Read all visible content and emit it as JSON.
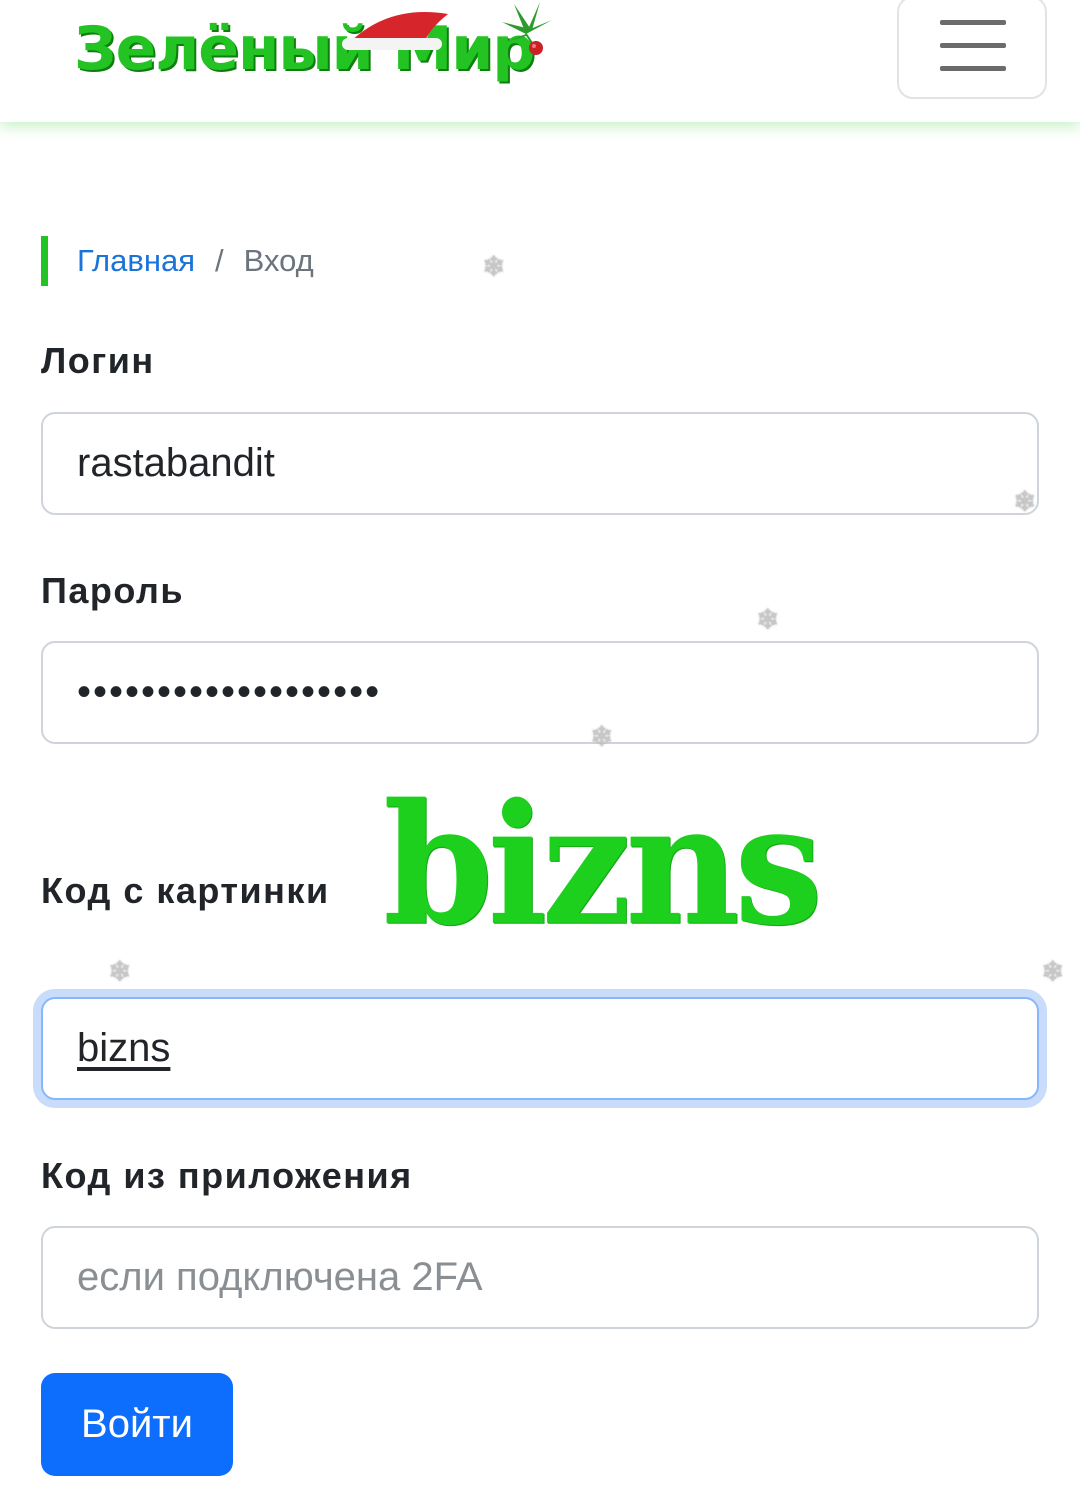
{
  "header": {
    "logo_text": "Зелёный Мир",
    "menu_icon": "hamburger-icon"
  },
  "breadcrumb": {
    "home": "Главная",
    "separator": "/",
    "current": "Вход"
  },
  "form": {
    "login_label": "Логин",
    "login_value": "rastabandit",
    "password_label": "Пароль",
    "password_value": "•••••••••••••••••••",
    "captcha_label": "Код с картинки",
    "captcha_image_text": "bizns",
    "captcha_value": "bizns",
    "app_code_label": "Код из приложения",
    "app_code_placeholder": "если подключена 2FA",
    "submit_label": "Войти"
  },
  "decor": {
    "snowflake_icon": "snowflake-icon",
    "snowflake_glyph": "❄"
  },
  "colors": {
    "brand_green": "#22c322",
    "link_blue": "#1a73d9",
    "button_blue": "#0d6efd",
    "focus_ring": "#86b7fe"
  }
}
